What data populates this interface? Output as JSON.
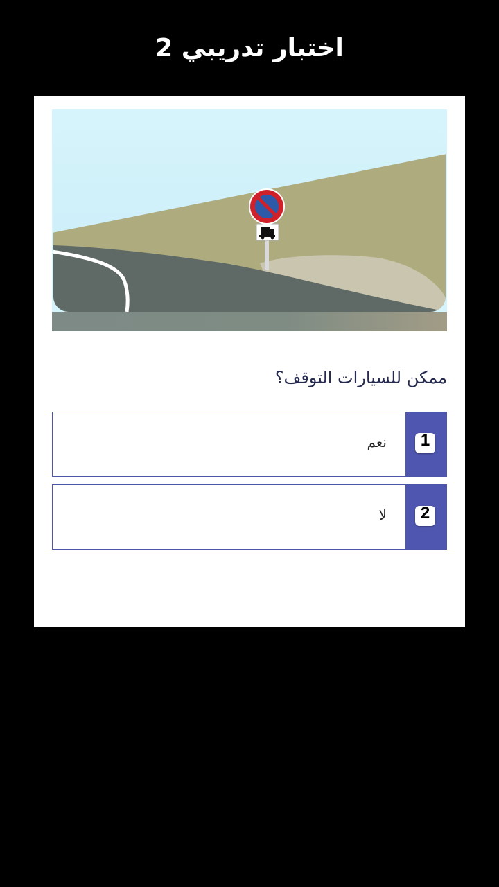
{
  "header": {
    "title": "اختبار تدريبي 2"
  },
  "quiz": {
    "question": "ممكن للسيارات التوقف؟",
    "answers": [
      {
        "number": "1",
        "label": "نعم"
      },
      {
        "number": "2",
        "label": "لا"
      }
    ],
    "colors": {
      "accent": "#4f56b0",
      "border": "#4c55a8",
      "question_text": "#262a4e"
    }
  },
  "illustration": {
    "description_icon": "no-parking-sign-with-truck-plate",
    "colors": {
      "sky": "#cdeef8",
      "hill": "#aeac7e",
      "road": "#5f6a66",
      "shoulder": "#c9c5ae",
      "sign_red": "#d0202a",
      "sign_blue": "#2d5aa8"
    }
  }
}
